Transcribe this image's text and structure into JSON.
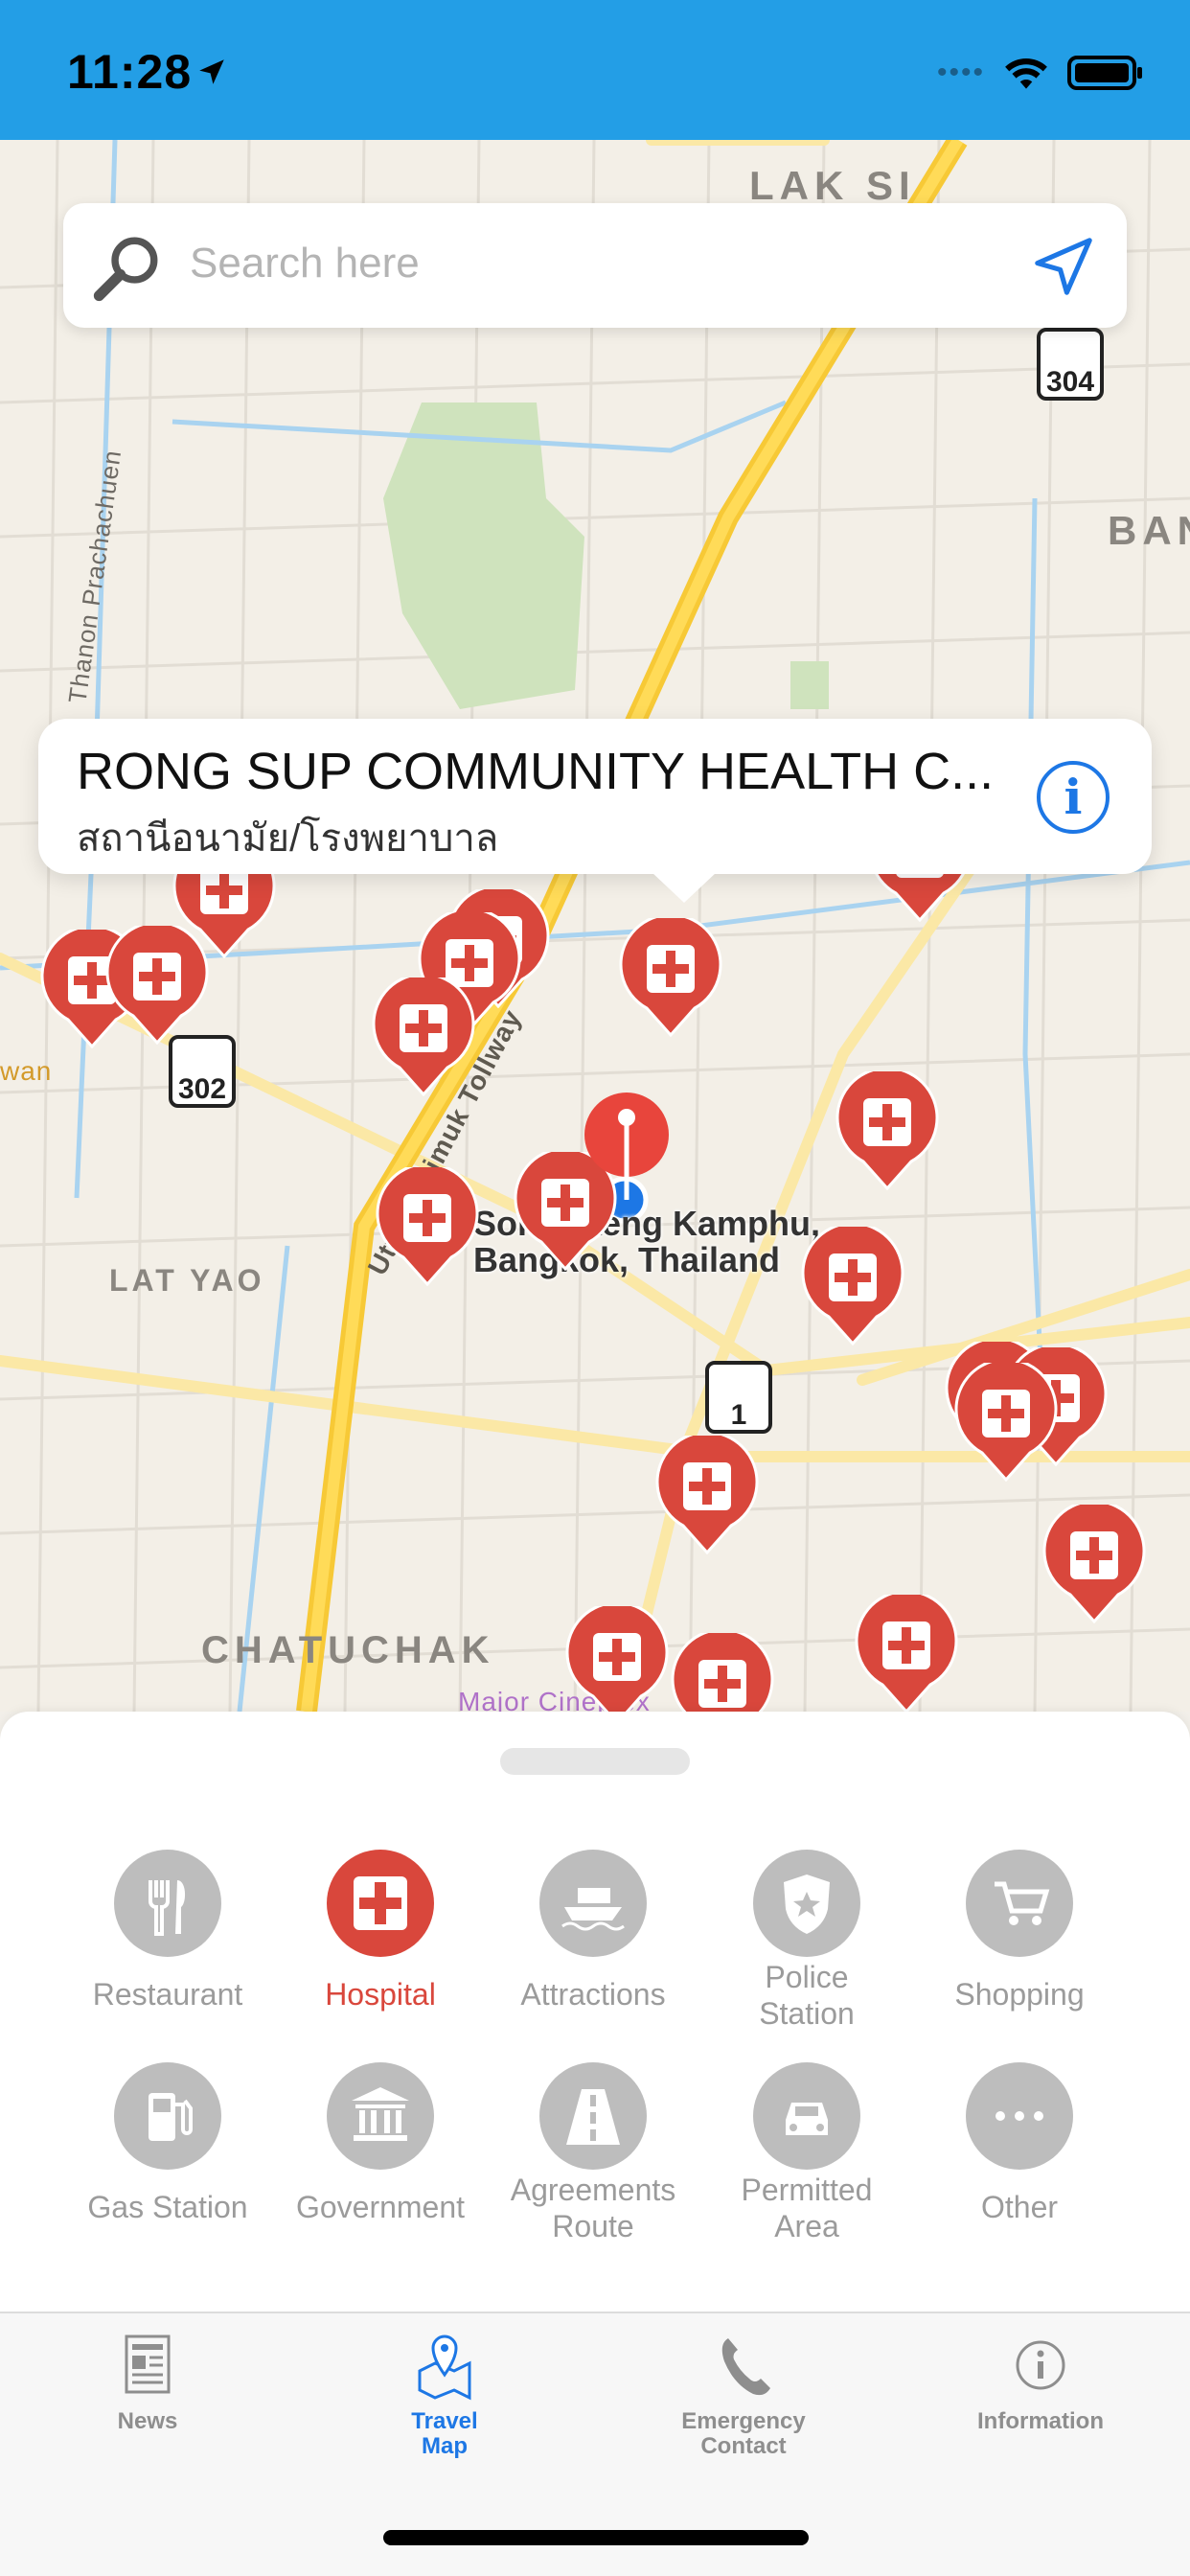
{
  "status_bar": {
    "time": "11:28",
    "bg_color": "#239ee6"
  },
  "search": {
    "placeholder": "Search here"
  },
  "map": {
    "district_labels": [
      "LAK SI",
      "BAN",
      "LAT YAO",
      "CHATUCHAK"
    ],
    "road_label": "Thanon Prachachuen",
    "road_label_2": "Uttaraphimuk Tollway",
    "poi_label": "Major Cineplex",
    "edge_label": "wan",
    "place_label_line1": "Soi Chaeng Kamphu,",
    "place_label_line2": "Bangkok, Thailand",
    "route_shields": [
      "304",
      "302",
      "1"
    ]
  },
  "callout": {
    "title": "RONG SUP COMMUNITY HEALTH C...",
    "subtitle": "สถานีอนามัย/โรงพยาบาล"
  },
  "categories": [
    {
      "label": "Restaurant",
      "icon": "fork-knife-icon",
      "active": false
    },
    {
      "label": "Hospital",
      "icon": "medical-cross-icon",
      "active": true
    },
    {
      "label": "Attractions",
      "icon": "boat-icon",
      "active": false
    },
    {
      "label": "Police\nStation",
      "icon": "police-badge-icon",
      "active": false
    },
    {
      "label": "Shopping",
      "icon": "cart-icon",
      "active": false
    },
    {
      "label": "Gas Station",
      "icon": "fuel-pump-icon",
      "active": false
    },
    {
      "label": "Government",
      "icon": "government-building-icon",
      "active": false
    },
    {
      "label": "Agreements\nRoute",
      "icon": "road-icon",
      "active": false
    },
    {
      "label": "Permitted\nArea",
      "icon": "car-icon",
      "active": false
    },
    {
      "label": "Other",
      "icon": "more-dots-icon",
      "active": false
    }
  ],
  "tabs": [
    {
      "label": "News",
      "icon": "newspaper-icon",
      "active": false
    },
    {
      "label": "Travel\nMap",
      "icon": "map-pin-icon",
      "active": true
    },
    {
      "label": "Emergency\nContact",
      "icon": "phone-icon",
      "active": false
    },
    {
      "label": "Information",
      "icon": "info-icon",
      "active": false
    }
  ],
  "colors": {
    "accent": "#1d77e5",
    "hospital_red": "#d9473c",
    "inactive_gray": "#bdbdbd"
  }
}
